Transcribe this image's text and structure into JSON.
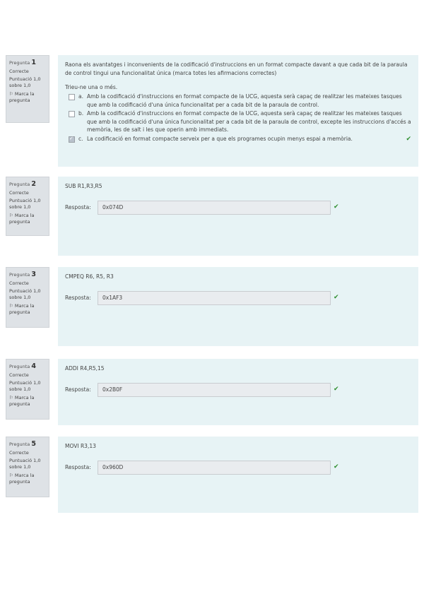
{
  "common": {
    "answer_label": "Resposta:",
    "state": "Correcte",
    "score": "Puntuació 1,0 sobre 1,0",
    "flag": "Marca la pregunta",
    "question_word": "Pregunta"
  },
  "questions": [
    {
      "number": "1",
      "text": "Raona els avantatges i inconvenients de la codificació d'instruccions en un format compacte davant a que cada bit de la paraula de control tingui una funcionalitat única (marca totes les afirmacions correctes)",
      "prompt": "Trieu-ne una o més.",
      "options": [
        {
          "letter": "a.",
          "text": "Amb la codificació d'instruccions en format compacte de la UCG, aquesta serà capaç de realitzar les mateixes tasques que amb la codificació d'una única funcionalitat per a cada bit de la paraula de control.",
          "checked": false
        },
        {
          "letter": "b.",
          "text": "Amb la codificació d'instruccions en format compacte de la UCG, aquesta serà capaç de realitzar les mateixes tasques que amb la codificació d'una única funcionalitat per a cada bit de la paraula de control, excepte les instruccions d'accés a memòria, les de salt i les que operin amb immediats.",
          "checked": false
        },
        {
          "letter": "c.",
          "text": "La codificació en format compacte serveix per a que els programes ocupin menys espai a memòria.",
          "checked": true
        }
      ]
    },
    {
      "number": "2",
      "text": "SUB R1,R3,R5",
      "answer": "0x074D"
    },
    {
      "number": "3",
      "text": "CMPEQ R6, R5, R3",
      "answer": "0x1AF3"
    },
    {
      "number": "4",
      "text": "ADDI R4,R5,15",
      "answer": "0x2B0F"
    },
    {
      "number": "5",
      "text": "MOVI R3,13",
      "answer": "0x960D"
    }
  ]
}
